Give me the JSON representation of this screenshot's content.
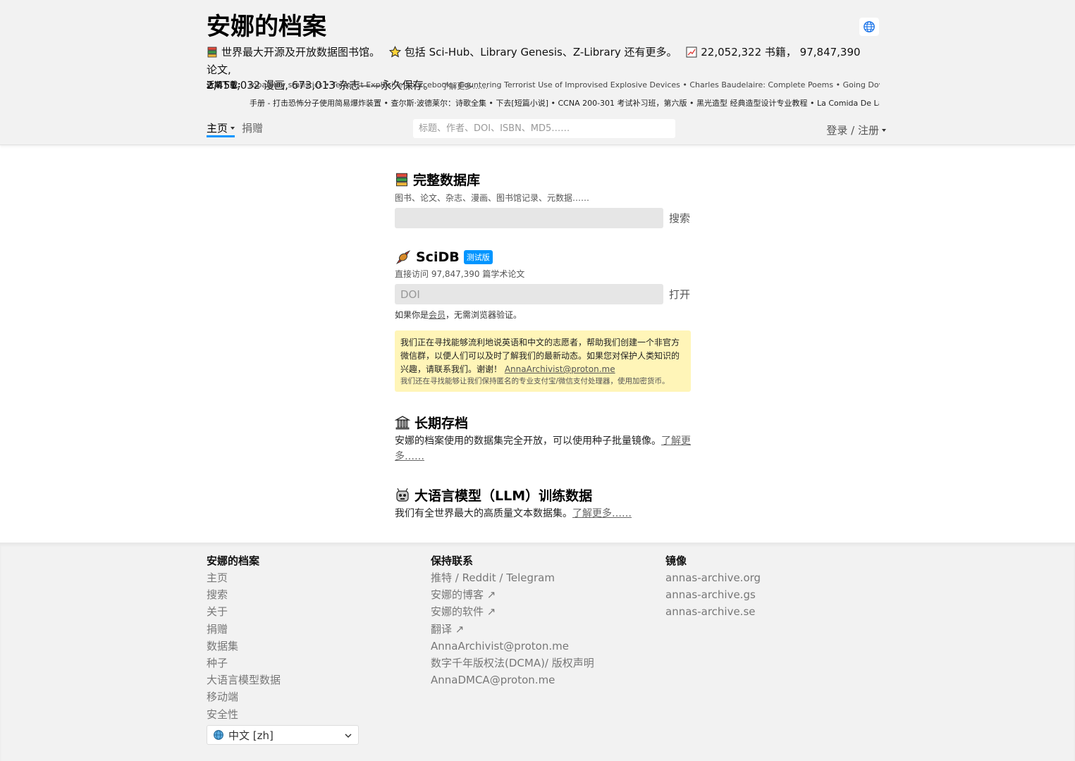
{
  "header": {
    "site_title": "安娜的档案",
    "tagline": {
      "part1": "世界最大开源及开放数据图书馆。",
      "part2": "包括 Sci-Hub、Library Genesis、Z-Library 还有更多。",
      "part3": "22,052,322 书籍， 97,847,390 论文,",
      "part4": "2,451,032 漫画, 673,013 杂志——永久保存。",
      "learn_more": "了解更多……"
    },
    "recent_label": "近期下载:",
    "recent_line1": "robability statistics • Terrorist Explosive Sourcebook - Countering Terrorist Use of Improvised Explosive Devices • Charles Baudelaire: Complete Poems • Going Down [Sh",
    "recent_line2": "手册 - 打击恐怖分子使用简易爆炸装置 • 查尔斯·波德莱尔：诗歌全集 • 下去[短篇小说] • CCNA 200-301 考试补习班，第六版 • 黑光造型 经典造型设计专业教程 • La Comida De La I",
    "nav": {
      "home": "主页",
      "donate": "捐赠"
    },
    "search_placeholder": "标题、作者、DOI、ISBN、MD5……",
    "login": "登录 / 注册"
  },
  "main": {
    "full_db": {
      "title": "完整数据库",
      "subtitle": "图书、论文、杂志、漫画、图书馆记录、元数据……",
      "button": "搜索"
    },
    "scidb": {
      "title": "SciDB",
      "badge": "测试版",
      "subtitle": "直接访问 97,847,390 篇学术论文",
      "placeholder": "DOI",
      "button": "打开",
      "note_pre": "如果你是",
      "note_link": "会员",
      "note_post": "，无需浏览器验证。"
    },
    "volunteer": {
      "text": "我们正在寻找能够流利地说英语和中文的志愿者，帮助我们创建一个非官方微信群，以便人们可以及时了解我们的最新动态。如果您对保护人类知识的兴趣，请联系我们。谢谢！",
      "email": "AnnaArchivist@proton.me",
      "small": "我们还在寻找能够让我们保持匿名的专业支付宝/微信支付处理器，使用加密货币。"
    },
    "archive": {
      "title": "长期存档",
      "text": "安娜的档案使用的数据集完全开放，可以使用种子批量镜像。",
      "link": "了解更多……"
    },
    "llm": {
      "title": "大语言模型（LLM）训练数据",
      "text": "我们有全世界最大的高质量文本数据集。",
      "link": "了解更多……"
    }
  },
  "footer": {
    "col1": {
      "title": "安娜的档案",
      "links": [
        "主页",
        "搜索",
        "关于",
        "捐赠",
        "数据集",
        "种子",
        "大语言模型数据",
        "移动端",
        "安全性"
      ]
    },
    "col2": {
      "title": "保持联系",
      "links": [
        "推特 / Reddit / Telegram",
        "安娜的博客 ↗",
        "安娜的软件 ↗",
        "翻译 ↗",
        "AnnaArchivist@proton.me",
        "数字千年版权法(DCMA)/ 版权声明",
        "AnnaDMCA@proton.me"
      ]
    },
    "col3": {
      "title": "镜像",
      "links": [
        "annas-archive.org",
        "annas-archive.gs",
        "annas-archive.se"
      ]
    },
    "language": "中文 [zh]"
  }
}
